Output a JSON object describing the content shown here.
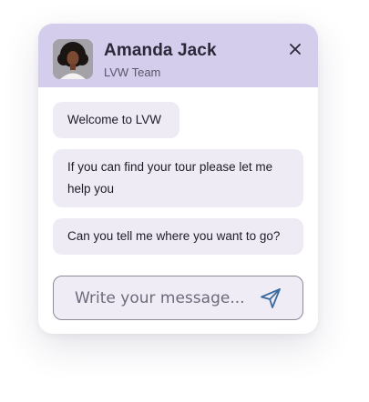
{
  "header": {
    "agent_name": "Amanda Jack",
    "team": "LVW Team",
    "avatar_icon": "agent-avatar",
    "close_icon": "close-icon",
    "background_color": "#d5cdec"
  },
  "messages": [
    {
      "text": "Welcome to LVW"
    },
    {
      "text": "If you can find your tour please let me help you"
    },
    {
      "text": "Can you tell me where you want to go?"
    }
  ],
  "composer": {
    "placeholder": "Write your message...",
    "value": "",
    "send_icon": "send-icon",
    "accent_color": "#3d6a9e"
  }
}
